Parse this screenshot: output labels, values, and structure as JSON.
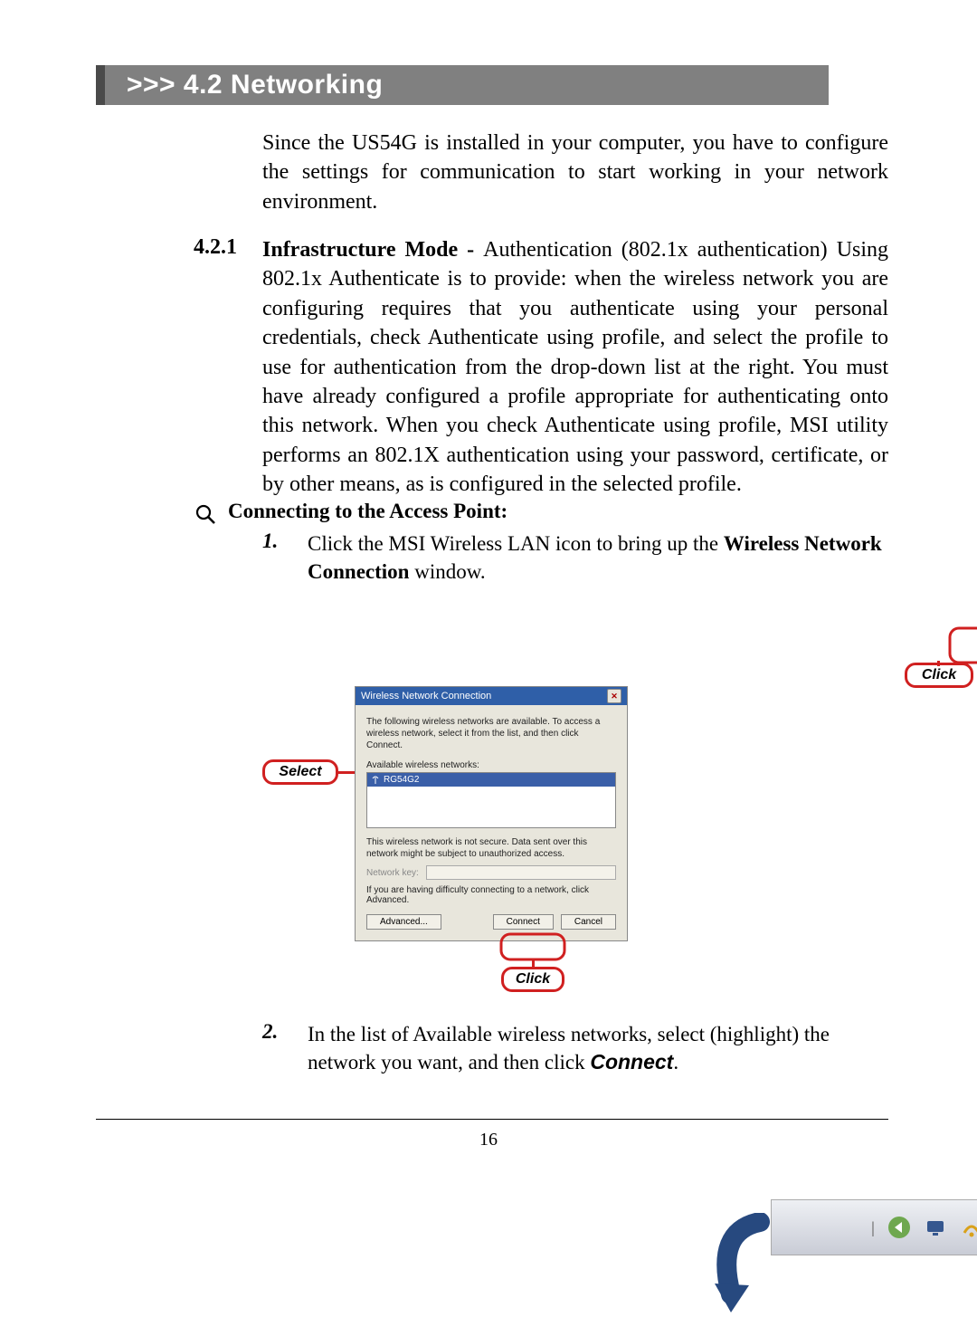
{
  "heading": ">>> 4.2  Networking",
  "intro": "Since the US54G is installed in your computer, you have to configure the settings for communication to start working in your network environment.",
  "sec_num": "4.2.1",
  "sec_lead_bold": "Infrastructure Mode - ",
  "sec_lead_rest": "Authentication (802.1x authentication)",
  "sec_body": "Using 802.1x Authenticate is to provide: when the wireless network you are configuring requires that you authenticate using your personal credentials, check Authenticate using profile, and select the profile to use for authentication from the drop-down list at the right.  You must have already configured a profile appropriate for authenticating onto this network.  When you check Authenticate using profile, MSI utility performs an 802.1X authentication using your password, certificate, or by other means, as is configured in the selected profile.",
  "bullet_title": "Connecting to the Access Point:",
  "step1_num": "1.",
  "step1_a": "Click the MSI Wireless LAN icon to bring up the ",
  "step1_b": "Wireless Network Connection",
  "step1_c": " window.",
  "callouts": {
    "select": "Select",
    "click_tray": "Click",
    "click_connect": "Click"
  },
  "dialog": {
    "title": "Wireless Network Connection",
    "instr": "The following wireless networks are available. To access a wireless network, select it from the list, and then click Connect.",
    "avail_label": "Available wireless networks:",
    "net_name": "RG54G2",
    "warn": "This wireless network is not secure. Data sent over this network might be subject to unauthorized access.",
    "key_label": "Network key:",
    "adv_note": "If you are having difficulty connecting to a network, click Advanced.",
    "btn_adv": "Advanced...",
    "btn_connect": "Connect",
    "btn_cancel": "Cancel"
  },
  "step2_num": "2.",
  "step2_a": "In the list of Available wireless networks, select (highlight) the network you want, and then click ",
  "step2_b": "Connect",
  "step2_c": ".",
  "page_number": "16"
}
